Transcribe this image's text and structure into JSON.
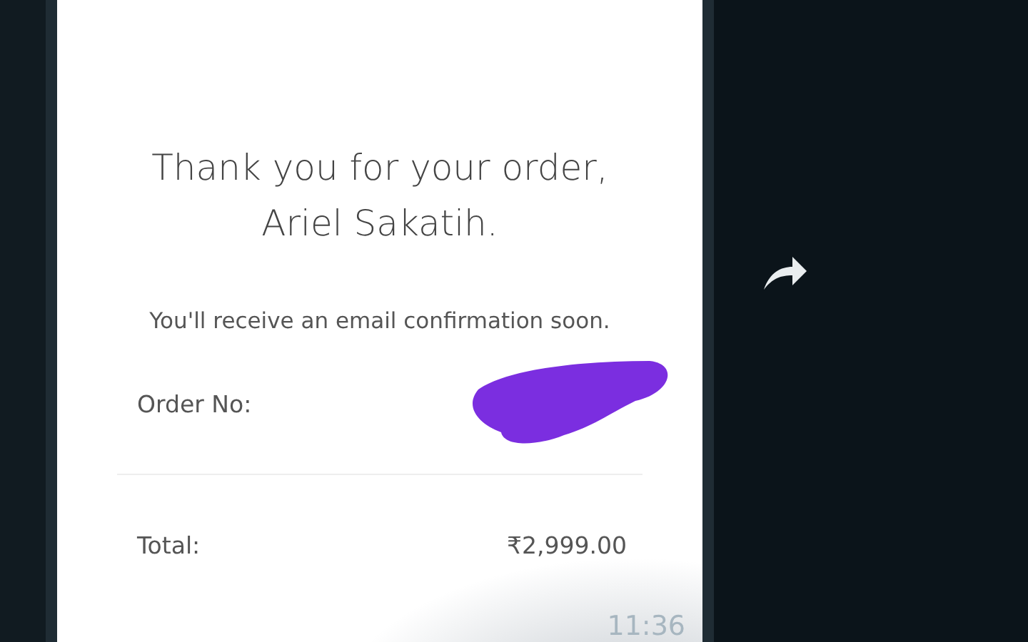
{
  "message": {
    "heading": [
      "Thank you for your order,",
      "Ariel Sakatih."
    ],
    "note": "You'll receive an email confirmation soon.",
    "rows": [
      {
        "label": "Order No:",
        "kind": "redacted"
      },
      {
        "label": "Total:",
        "kind": "text",
        "value": "₹2,999.00"
      }
    ],
    "time": "11:36"
  }
}
